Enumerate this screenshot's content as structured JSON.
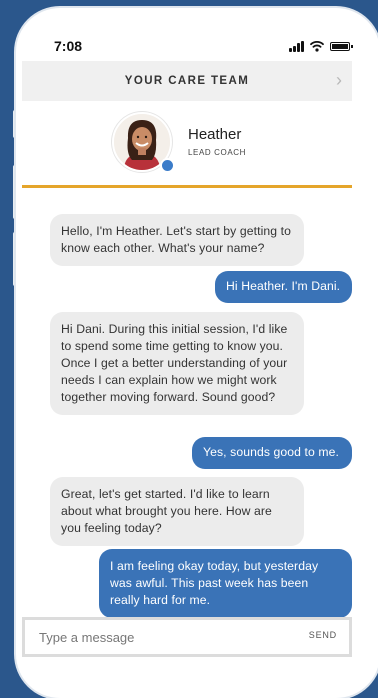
{
  "status_bar": {
    "time": "7:08"
  },
  "header": {
    "title": "YOUR CARE TEAM",
    "chevron_icon": "chevron-right-icon"
  },
  "coach": {
    "name": "Heather",
    "role": "LEAD COACH",
    "avatar_icon": "coach-avatar",
    "online": true
  },
  "colors": {
    "accent": "#e5a52a",
    "outgoing": "#3a73b7",
    "incoming": "#ececec",
    "background": "#2b578c"
  },
  "messages": [
    {
      "from": "coach",
      "text": "Hello, I'm Heather. Let's start by getting to know each other. What's your name?"
    },
    {
      "from": "user",
      "text": "Hi Heather. I'm Dani."
    },
    {
      "from": "coach",
      "text": "Hi Dani. During this initial session, I'd like to spend some time getting to know you. Once I get a better understanding of your needs I can explain how we might work together moving forward. Sound good?"
    },
    {
      "from": "user",
      "text": "Yes, sounds good to me."
    },
    {
      "from": "coach",
      "text": "Great, let's get started. I'd like to learn about what brought you here. How are you feeling today?"
    },
    {
      "from": "user",
      "text": "I am feeling okay today, but yesterday was awful. This past week has been really hard for me."
    }
  ],
  "composer": {
    "placeholder": "Type a message",
    "value": "",
    "send_label": "SEND"
  }
}
